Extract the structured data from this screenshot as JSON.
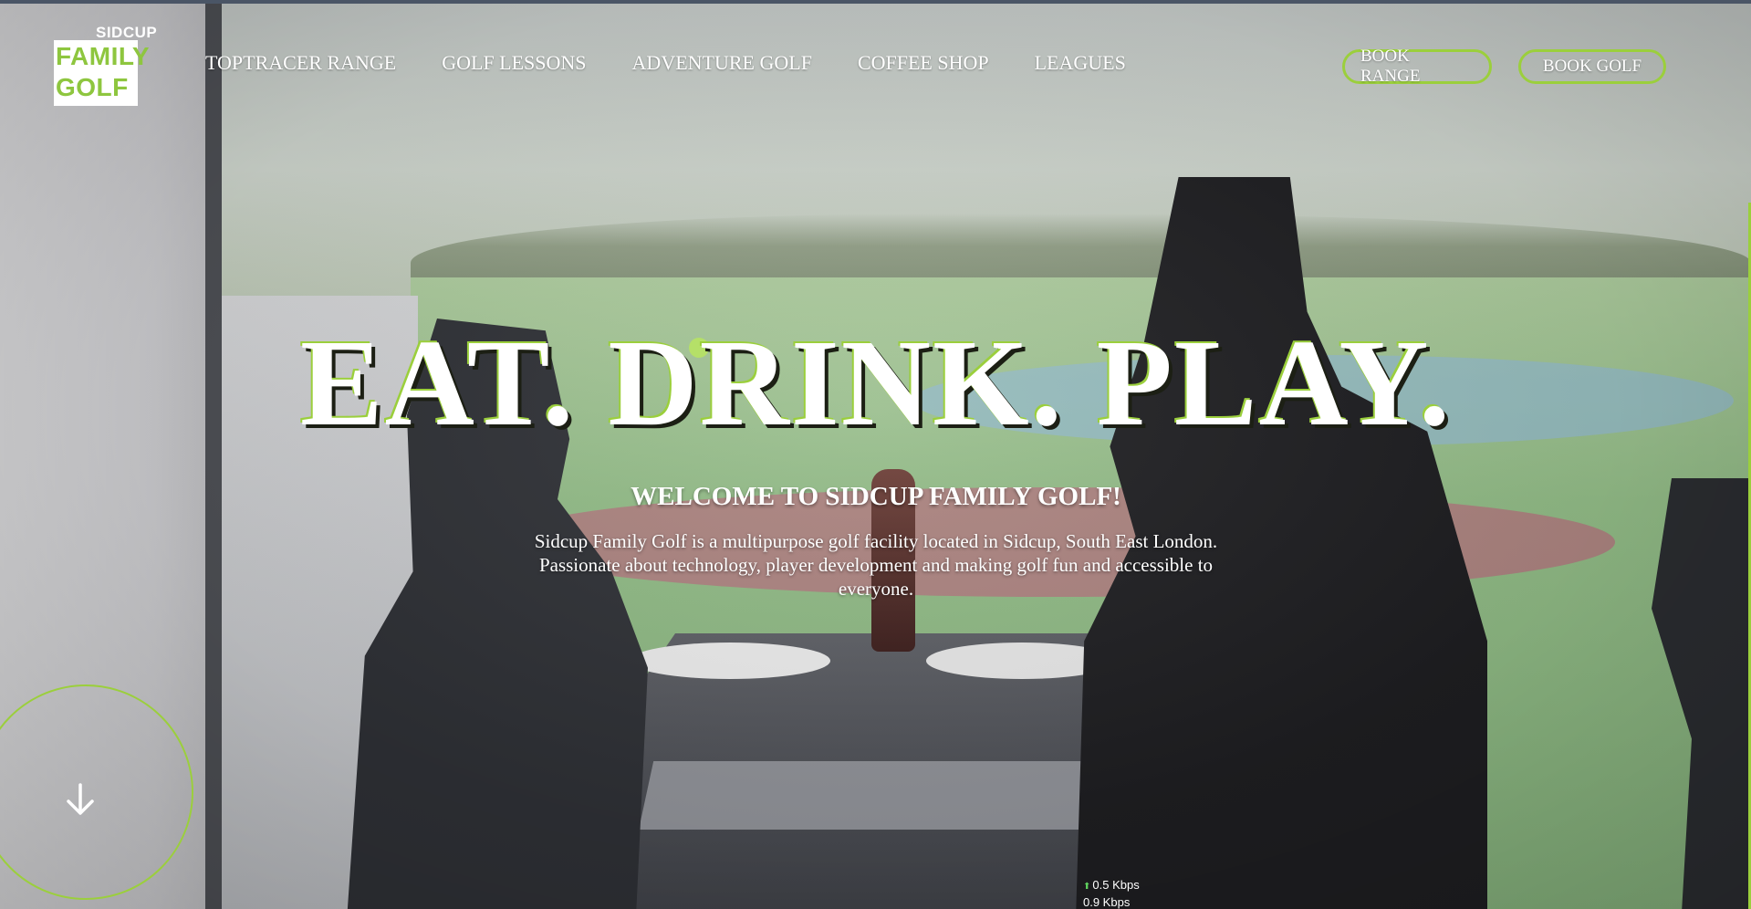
{
  "logo": {
    "top": "SIDCUP",
    "line1": "FAMILY",
    "line2": "GOLF"
  },
  "nav": {
    "items": [
      {
        "label": "TOPTRACER RANGE"
      },
      {
        "label": "GOLF LESSONS"
      },
      {
        "label": "ADVENTURE GOLF"
      },
      {
        "label": "COFFEE SHOP"
      },
      {
        "label": "LEAGUES"
      }
    ],
    "book_range": "BOOK RANGE",
    "book_golf": "BOOK GOLF"
  },
  "hero": {
    "title": "EAT. DRINK. PLAY.",
    "subtitle": "WELCOME TO SIDCUP FAMILY GOLF!",
    "description": "Sidcup Family Golf is a multipurpose golf facility located in Sidcup, South East London. Passionate about technology, player development and making golf fun and accessible to everyone."
  },
  "speed": {
    "upload": "0.5 Kbps",
    "download": "0.9 Kbps"
  },
  "colors": {
    "accent": "#9bcf3c",
    "logo_green": "#8ec63f",
    "text": "#ffffff"
  },
  "icons": {
    "scroll": "arrow-down-icon"
  }
}
